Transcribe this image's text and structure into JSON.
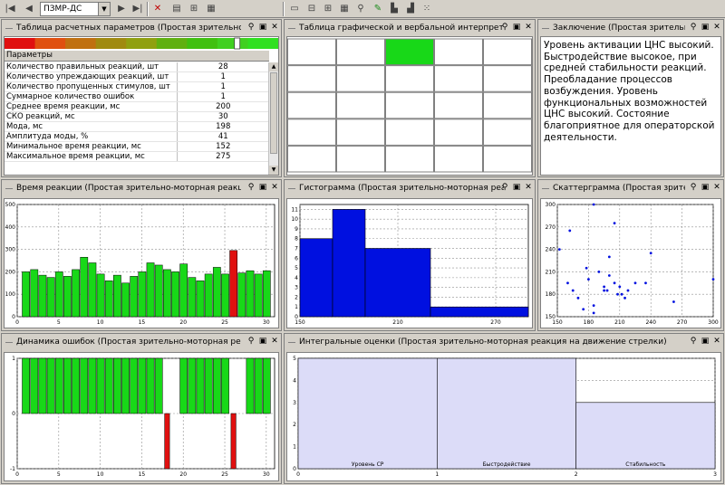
{
  "toolbar": {
    "profile_select": "ПЗМР-ДС",
    "nav_first_icon": "first-icon",
    "nav_prev_icon": "prev-icon",
    "nav_next_icon": "next-icon",
    "nav_last_icon": "last-icon"
  },
  "panels": {
    "params": {
      "title": "Таблица расчетных параметров (Простая зрительно-мотор"
    },
    "interp": {
      "title": "Таблица графической и вербальной интерпретаци"
    },
    "conclusion": {
      "title": "Заключение (Простая зрительн"
    },
    "reaction": {
      "title": "Время реакции (Простая зрительно-моторная реакция на д"
    },
    "histogram": {
      "title": "Гистограмма (Простая зрительно-моторная реакци"
    },
    "scatter": {
      "title": "Скаттерграмма (Простая зрите"
    },
    "errors": {
      "title": "Динамика ошибок (Простая зрительно-моторная реакция"
    },
    "integral": {
      "title": "Интегральные оценки (Простая зрительно-моторная реакция на движение стрелки)"
    }
  },
  "params_table": {
    "header": "Параметры",
    "rows": [
      {
        "name": "Количество правильных реакций, шт",
        "value": "28"
      },
      {
        "name": "Количество упреждающих реакций, шт",
        "value": "1"
      },
      {
        "name": "Количество пропущенных стимулов, шт",
        "value": "1"
      },
      {
        "name": "Суммарное количество ошибок",
        "value": "1"
      },
      {
        "name": "Среднее время реакции, мс",
        "value": "200"
      },
      {
        "name": "СКО реакций, мс",
        "value": "30"
      },
      {
        "name": "Мода, мс",
        "value": "198"
      },
      {
        "name": "Амплитуда моды, %",
        "value": "41"
      },
      {
        "name": "Минимальное время реакции, мс",
        "value": "152"
      },
      {
        "name": "Максимальное время реакции, мс",
        "value": "275"
      }
    ],
    "scale_colors": [
      "#e01010",
      "#e05010",
      "#c07010",
      "#a08a10",
      "#90a010",
      "#60b010",
      "#40c010",
      "#40d020",
      "#30e020"
    ],
    "scale_marker": 0.85
  },
  "conclusion_text": "Уровень активации ЦНС высокий. Быстродействие высокое, при средней стабильности реакций. Преобладание процессов возбуждения. Уровень функциональных возможностей ЦНС высокий. Состояние благоприятное для операторской деятельности.",
  "colors": {
    "green": "#18d818",
    "red": "#e01010",
    "blue": "#0010e0",
    "lavender": "#dcdcf8",
    "hatch": "#7cd87c"
  },
  "chart_data": [
    {
      "type": "bar",
      "name": "reaction",
      "x": [
        1,
        2,
        3,
        4,
        5,
        6,
        7,
        8,
        9,
        10,
        11,
        12,
        13,
        14,
        15,
        16,
        17,
        18,
        19,
        20,
        21,
        22,
        23,
        24,
        25,
        26,
        27,
        28,
        29,
        30
      ],
      "values": [
        200,
        210,
        185,
        175,
        200,
        180,
        210,
        265,
        240,
        190,
        160,
        185,
        150,
        180,
        200,
        240,
        230,
        210,
        200,
        235,
        175,
        160,
        190,
        220,
        190,
        295,
        195,
        205,
        190,
        205
      ],
      "highlight_index": 25,
      "y_ticks": [
        "0",
        "100",
        "200",
        "300",
        "400",
        "500"
      ],
      "x_ticks": [
        "0",
        "5",
        "10",
        "15",
        "20",
        "25",
        "30"
      ],
      "ylim": [
        0,
        500
      ],
      "band": [
        150,
        275
      ]
    },
    {
      "type": "bar",
      "name": "histogram",
      "bins": [
        [
          150,
          170,
          8
        ],
        [
          170,
          190,
          11
        ],
        [
          190,
          230,
          7
        ],
        [
          230,
          290,
          1
        ]
      ],
      "y_ticks": [
        "0",
        "1",
        "2",
        "3",
        "4",
        "5",
        "6",
        "7",
        "8",
        "9",
        "10",
        "11"
      ],
      "x_ticks": [
        "150",
        "210",
        "270"
      ],
      "ylim": [
        0,
        11.5
      ],
      "band": [
        150,
        240
      ]
    },
    {
      "type": "scatter",
      "name": "scatter",
      "points": [
        [
          152,
          240
        ],
        [
          160,
          195
        ],
        [
          165,
          185
        ],
        [
          170,
          175
        ],
        [
          175,
          160
        ],
        [
          180,
          200
        ],
        [
          185,
          155
        ],
        [
          185,
          165
        ],
        [
          190,
          210
        ],
        [
          195,
          185
        ],
        [
          200,
          230
        ],
        [
          200,
          205
        ],
        [
          205,
          195
        ],
        [
          210,
          190
        ],
        [
          212,
          180
        ],
        [
          215,
          175
        ],
        [
          225,
          195
        ],
        [
          235,
          195
        ],
        [
          205,
          275
        ],
        [
          178,
          215
        ],
        [
          198,
          185
        ],
        [
          240,
          235
        ],
        [
          262,
          170
        ],
        [
          300,
          200
        ],
        [
          185,
          300
        ],
        [
          162,
          265
        ],
        [
          195,
          190
        ],
        [
          208,
          180
        ],
        [
          218,
          185
        ]
      ],
      "y_ticks": [
        "150",
        "180",
        "210",
        "240",
        "270",
        "300"
      ],
      "x_ticks": [
        "150",
        "180",
        "210",
        "240",
        "270",
        "300"
      ],
      "xlim": [
        150,
        300
      ],
      "ylim": [
        150,
        300
      ],
      "band": [
        150,
        280
      ]
    },
    {
      "type": "bar",
      "name": "errors",
      "values": [
        1,
        1,
        1,
        1,
        1,
        1,
        1,
        1,
        1,
        1,
        1,
        1,
        1,
        1,
        1,
        1,
        1,
        -1,
        0,
        1,
        1,
        1,
        1,
        1,
        1,
        -1,
        0,
        1,
        1,
        1
      ],
      "y_ticks": [
        "-1",
        "0",
        "1"
      ],
      "x_ticks": [
        "0",
        "5",
        "10",
        "15",
        "20",
        "25",
        "30"
      ],
      "ylim": [
        -1,
        1
      ]
    },
    {
      "type": "bar",
      "name": "integral",
      "categories": [
        "Уровень СР",
        "Быстродействие",
        "Стабильность"
      ],
      "values": [
        5,
        5,
        3
      ],
      "y_ticks": [
        "0",
        "1",
        "2",
        "3",
        "4",
        "5"
      ],
      "x_ticks": [
        "0",
        "1",
        "2",
        "3"
      ],
      "ylim": [
        0,
        5
      ]
    }
  ]
}
